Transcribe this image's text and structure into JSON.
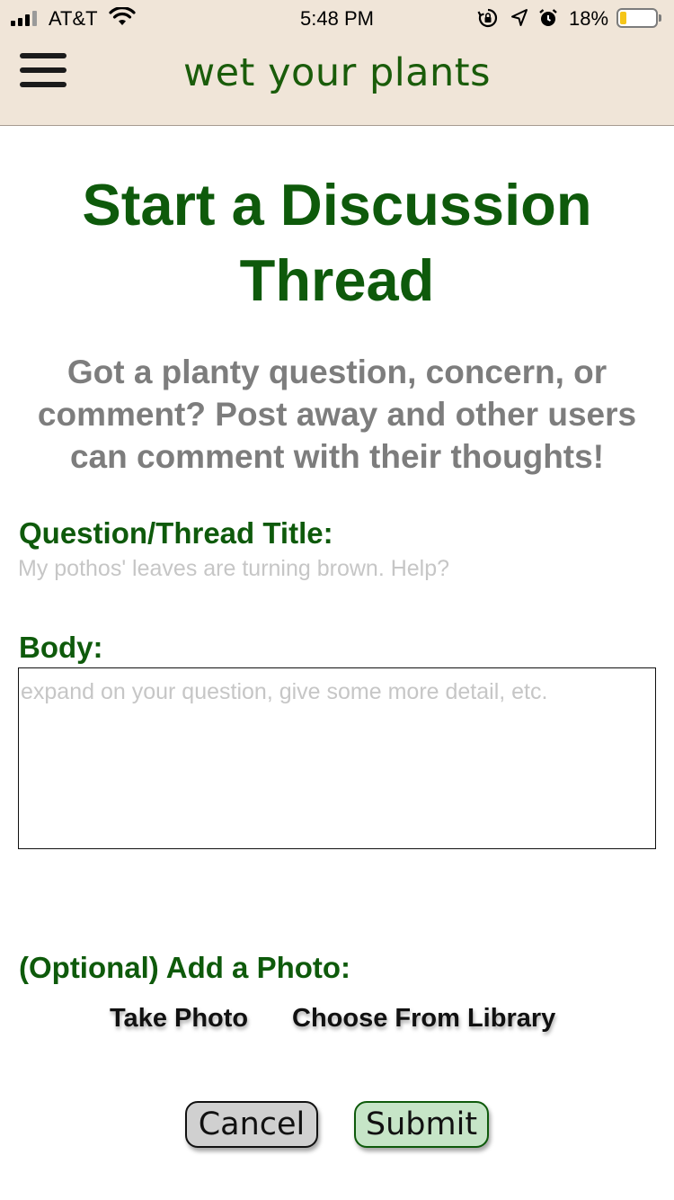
{
  "status_bar": {
    "carrier": "AT&T",
    "time": "5:48 PM",
    "battery_percent": "18%",
    "battery_level": 0.18,
    "signal_bars": 3,
    "icons": [
      "wifi-icon",
      "orientation-lock-icon",
      "location-icon",
      "alarm-icon",
      "battery-icon"
    ]
  },
  "header": {
    "brand": "wet your plants",
    "menu_icon": "hamburger-menu-icon",
    "background_color": "#f0e5d8",
    "brand_color": "#1a5c0a"
  },
  "page": {
    "title": "Start a Discussion Thread",
    "subtitle": "Got a planty question, concern, or comment? Post away and other users can comment with their thoughts!",
    "accent_color": "#0e5a0b"
  },
  "form": {
    "title_label": "Question/Thread Title:",
    "title_value": "",
    "title_placeholder": "My pothos' leaves are turning brown. Help?",
    "body_label": "Body:",
    "body_value": "",
    "body_placeholder": "expand on your question, give some more detail, etc.",
    "photo_label": "(Optional) Add a Photo:",
    "take_photo": "Take Photo",
    "choose_library": "Choose From Library"
  },
  "actions": {
    "cancel": "Cancel",
    "submit": "Submit"
  }
}
